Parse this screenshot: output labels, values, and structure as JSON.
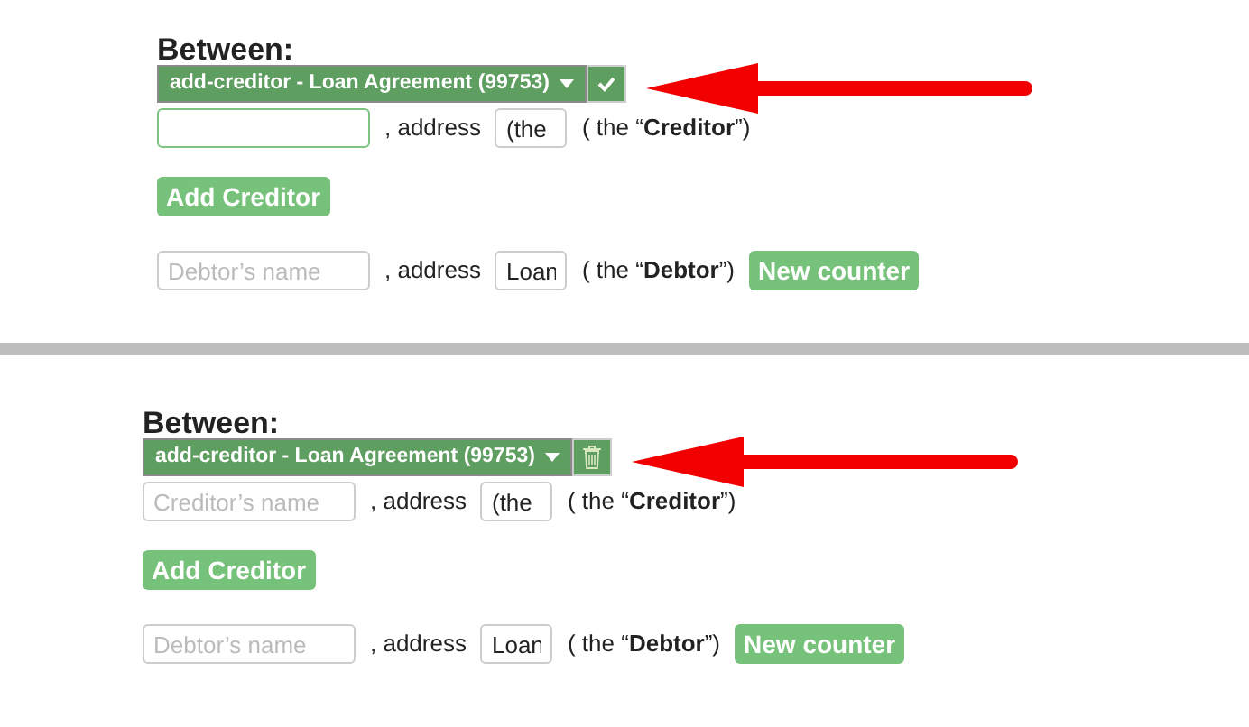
{
  "panels": [
    {
      "heading": "Between:",
      "toolbar": {
        "label": "add-creditor - Loan Agreement (99753)",
        "kind": "confirm"
      },
      "creditor_field": {
        "focused": true
      },
      "creditor_label": ", address",
      "creditor_address": "(the",
      "creditor_role": "( the “**Creditor**”)",
      "add_button": "Add Creditor",
      "debtor_field": {
        "placeholder": "Debtor’s name"
      },
      "debtor_label": ", address",
      "debtor_address": "Loan",
      "debtor_role": "( the “**Debtor**”)",
      "counter_button": "New counter"
    },
    {
      "heading": "Between:",
      "toolbar": {
        "label": "add-creditor - Loan Agreement (99753)",
        "kind": "delete"
      },
      "creditor_field": {
        "focused": false,
        "placeholder": "Creditor’s name"
      },
      "creditor_label": ", address",
      "creditor_address": "(the",
      "creditor_role": "( the “**Creditor**”)",
      "add_button": "Add Creditor",
      "debtor_field": {
        "placeholder": "Debtor’s name"
      },
      "debtor_label": ", address",
      "debtor_address": "Loan",
      "debtor_role": "( the “**Debtor**”)",
      "counter_button": "New counter"
    }
  ]
}
